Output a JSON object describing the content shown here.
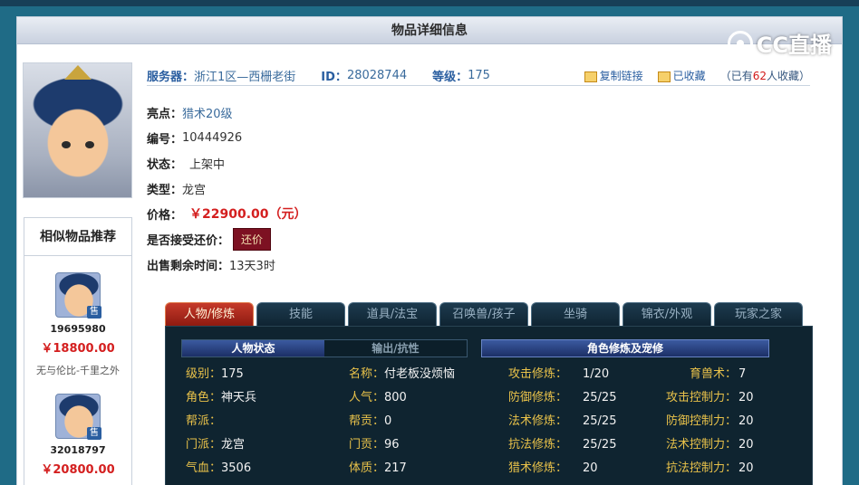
{
  "page": {
    "title": "物品详细信息"
  },
  "watermark": {
    "text": "CC直播"
  },
  "info": {
    "server_label": "服务器：",
    "server_value": "浙江1区—西栅老街",
    "id_label": "ID：",
    "id_value": "28028744",
    "level_label": "等级：",
    "level_value": "175",
    "copy_link": "复制链接",
    "favorited": "已收藏",
    "fav_prefix": "（已有",
    "fav_count": "62",
    "fav_suffix": "人收藏）"
  },
  "detail": {
    "highlight_label": "亮点：",
    "highlight_value": "猎术20级",
    "serial_label": "编号：",
    "serial_value": "10444926",
    "status_label": "状态：",
    "status_value": "上架中",
    "type_label": "类型：",
    "type_value": "龙宫",
    "price_label": "价格：",
    "price_value": "￥22900.00（元）",
    "haggle_label": "是否接受还价：",
    "haggle_button": "还价",
    "remaining_label": "出售剩余时间：",
    "remaining_value": "13天3时"
  },
  "similar": {
    "title": "相似物品推荐",
    "items": [
      {
        "id": "19695980",
        "price": "￥18800.00",
        "name": "无与伦比-千里之外",
        "tag": "售"
      },
      {
        "id": "32018797",
        "price": "￥20800.00",
        "name": "",
        "tag": "售"
      }
    ]
  },
  "tabs": [
    {
      "label": "人物/修炼",
      "active": true
    },
    {
      "label": "技能",
      "active": false
    },
    {
      "label": "道具/法宝",
      "active": false
    },
    {
      "label": "召唤兽/孩子",
      "active": false
    },
    {
      "label": "坐骑",
      "active": false
    },
    {
      "label": "锦衣/外观",
      "active": false
    },
    {
      "label": "玩家之家",
      "active": false
    }
  ],
  "panel": {
    "sub_tab_status": "人物状态",
    "sub_tab_resist": "输出/抗性",
    "section_cultivation": "角色修炼及宠修",
    "col1": [
      {
        "k": "级别：",
        "v": "175"
      },
      {
        "k": "角色：",
        "v": "神天兵"
      },
      {
        "k": "帮派：",
        "v": ""
      },
      {
        "k": "门派：",
        "v": "龙宫"
      },
      {
        "k": "气血：",
        "v": "3506"
      }
    ],
    "col2": [
      {
        "k": "名称：",
        "v": "付老板没烦恼"
      },
      {
        "k": "人气：",
        "v": "800"
      },
      {
        "k": "帮贡：",
        "v": "0"
      },
      {
        "k": "门贡：",
        "v": "96"
      },
      {
        "k": "体质：",
        "v": "217"
      }
    ],
    "col3": [
      {
        "k": "攻击修炼：",
        "v": "1/20"
      },
      {
        "k": "防御修炼：",
        "v": "25/25"
      },
      {
        "k": "法术修炼：",
        "v": "25/25"
      },
      {
        "k": "抗法修炼：",
        "v": "25/25"
      },
      {
        "k": "猎术修炼：",
        "v": "20"
      }
    ],
    "col4": [
      {
        "k": "育兽术：",
        "v": "7"
      },
      {
        "k": "攻击控制力：",
        "v": "20"
      },
      {
        "k": "防御控制力：",
        "v": "20"
      },
      {
        "k": "法术控制力：",
        "v": "20"
      },
      {
        "k": "抗法控制力：",
        "v": "20"
      }
    ]
  }
}
